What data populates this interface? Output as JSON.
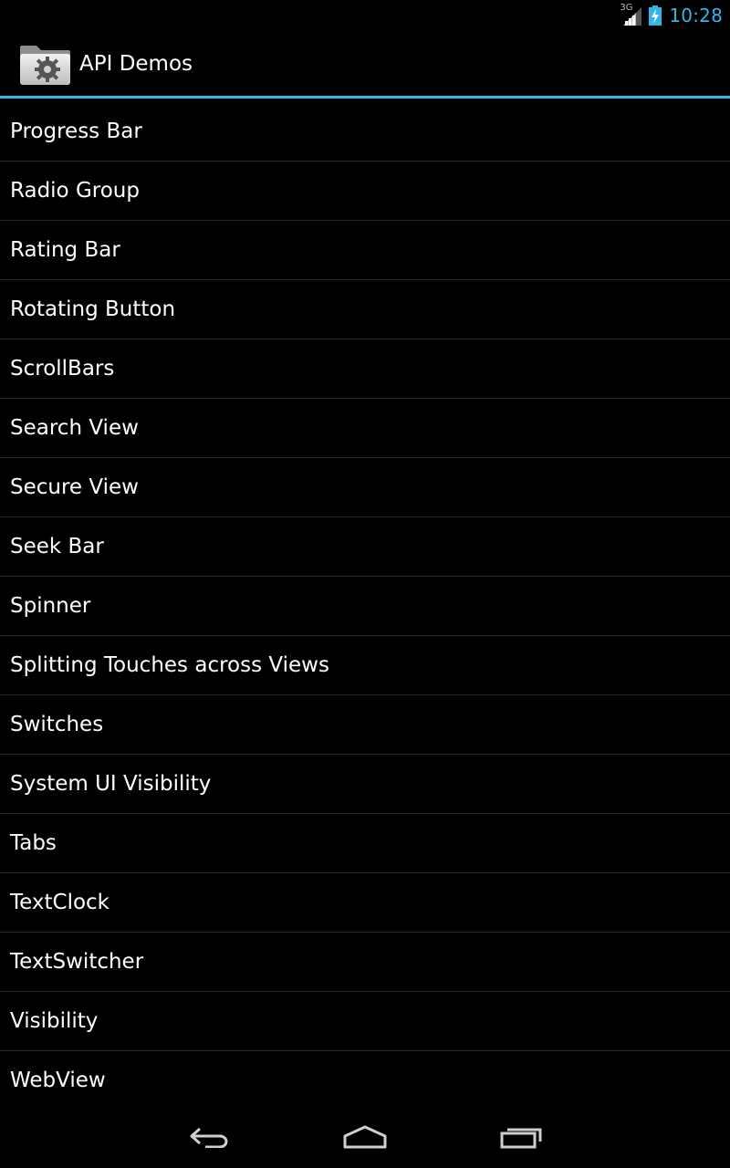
{
  "status_bar": {
    "network_type": "3G",
    "time": "10:28",
    "accent_color": "#33b5e5",
    "signal_icon": "cell-signal-icon",
    "battery_icon": "battery-charging-icon"
  },
  "action_bar": {
    "title": "API Demos",
    "icon": "folder-gear-icon",
    "underline_color": "#33b5e5"
  },
  "list": {
    "items": [
      {
        "label": "Progress Bar"
      },
      {
        "label": "Radio Group"
      },
      {
        "label": "Rating Bar"
      },
      {
        "label": "Rotating Button"
      },
      {
        "label": "ScrollBars"
      },
      {
        "label": "Search View"
      },
      {
        "label": "Secure View"
      },
      {
        "label": "Seek Bar"
      },
      {
        "label": "Spinner"
      },
      {
        "label": "Splitting Touches across Views"
      },
      {
        "label": "Switches"
      },
      {
        "label": "System UI Visibility"
      },
      {
        "label": "Tabs"
      },
      {
        "label": "TextClock"
      },
      {
        "label": "TextSwitcher"
      },
      {
        "label": "Visibility"
      },
      {
        "label": "WebView"
      }
    ]
  },
  "nav_bar": {
    "back_icon": "back-icon",
    "home_icon": "home-icon",
    "recents_icon": "recents-icon"
  }
}
